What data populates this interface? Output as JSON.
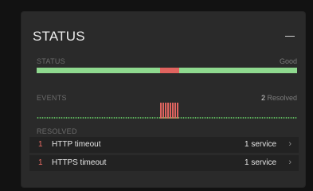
{
  "card": {
    "title": "STATUS",
    "collapse_glyph": "—"
  },
  "status": {
    "label": "STATUS",
    "value": "Good",
    "segments": [
      {
        "state": "good",
        "fraction": 0.473,
        "color": "#8fd98f"
      },
      {
        "state": "incident",
        "fraction": 0.073,
        "color": "#e0645f"
      },
      {
        "state": "good",
        "fraction": 0.454,
        "color": "#8fd98f"
      }
    ]
  },
  "events": {
    "label": "EVENTS",
    "count": "2",
    "count_suffix": "Resolved",
    "timeline_color": "#5fb85f",
    "spike_color": "#e0645f"
  },
  "resolved": {
    "label": "RESOLVED",
    "items": [
      {
        "count": "1",
        "name": "HTTP timeout",
        "services": "1 service"
      },
      {
        "count": "1",
        "name": "HTTPS timeout",
        "services": "1 service"
      }
    ],
    "chevron": "›"
  },
  "icons": {
    "collapse": "minus-icon",
    "row_chevron": "chevron-right-icon"
  }
}
